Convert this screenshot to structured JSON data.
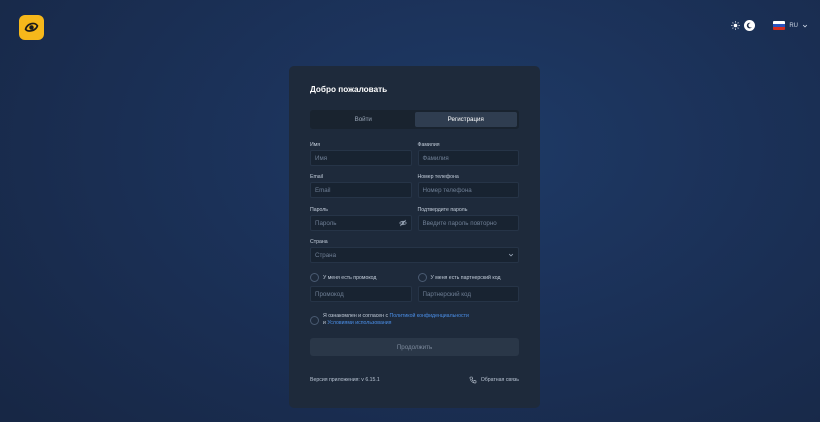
{
  "header": {
    "language_code": "RU"
  },
  "form": {
    "title": "Добро пожаловать",
    "tabs": [
      {
        "label": "Войти",
        "active": false
      },
      {
        "label": "Регистрация",
        "active": true
      }
    ],
    "first_name": {
      "label": "Имя",
      "placeholder": "Имя"
    },
    "last_name": {
      "label": "Фамилия",
      "placeholder": "Фамилия"
    },
    "email": {
      "label": "Email",
      "placeholder": "Email"
    },
    "phone": {
      "label": "Номер телефона",
      "placeholder": "Номер телефона"
    },
    "password": {
      "label": "Пароль",
      "placeholder": "Пароль"
    },
    "password_confirm": {
      "label": "Подтвердите пароль",
      "placeholder": "Введите пароль повторно"
    },
    "country": {
      "label": "Страна",
      "placeholder": "Страна"
    },
    "promo": {
      "checkbox_label": "У меня есть промокод",
      "placeholder": "Промокод"
    },
    "partner": {
      "checkbox_label": "У меня есть партнерский код",
      "placeholder": "Партнерский код"
    },
    "terms": {
      "prefix": "Я ознакомлен и согласен с",
      "privacy_link": "Политикой конфиденциальности",
      "conjunction": "и",
      "terms_link": "Условиями использования"
    },
    "continue_label": "Продолжить",
    "version_text": "Версия приложения: v 6.15.1",
    "feedback_label": "Обратная связь"
  },
  "icons": {
    "logo": "eye-logo-icon",
    "theme_light": "sun-icon",
    "theme_dark": "moon-icon",
    "flag": "russia-flag-icon",
    "dropdown": "chevron-down-icon",
    "password_visibility": "eye-off-icon",
    "feedback": "phone-icon"
  },
  "colors": {
    "accent": "#f6b81b",
    "link": "#4b8fe8",
    "card": "#1e2a3b"
  }
}
